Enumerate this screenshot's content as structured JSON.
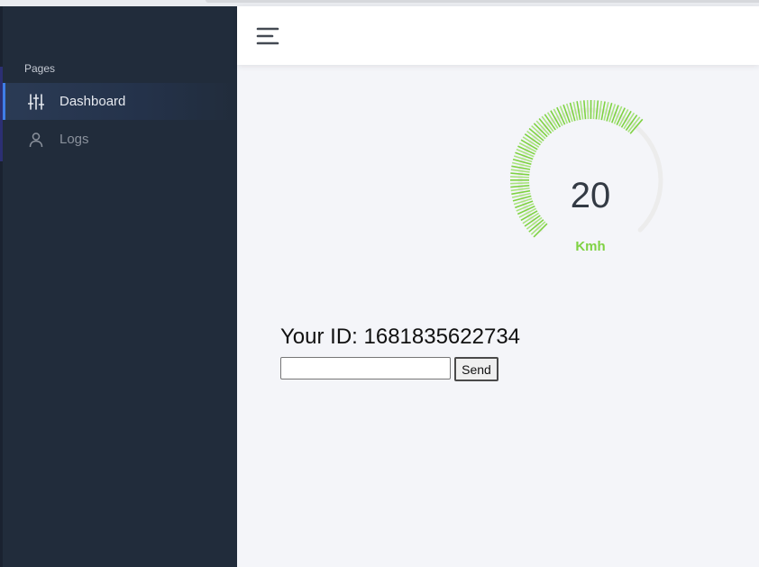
{
  "sidebar": {
    "section_title": "Pages",
    "items": [
      {
        "label": "Dashboard",
        "icon": "sliders-icon",
        "active": true
      },
      {
        "label": "Logs",
        "icon": "user-icon",
        "active": false
      }
    ]
  },
  "header": {
    "menu_icon": "hamburger-menu-icon"
  },
  "gauge": {
    "value": "20",
    "unit": "Kmh",
    "fill_fraction": 0.65,
    "color": "#7fd243"
  },
  "connection": {
    "id_text": "Your ID: 1681835622734",
    "input_value": "",
    "send_label": "Send"
  }
}
